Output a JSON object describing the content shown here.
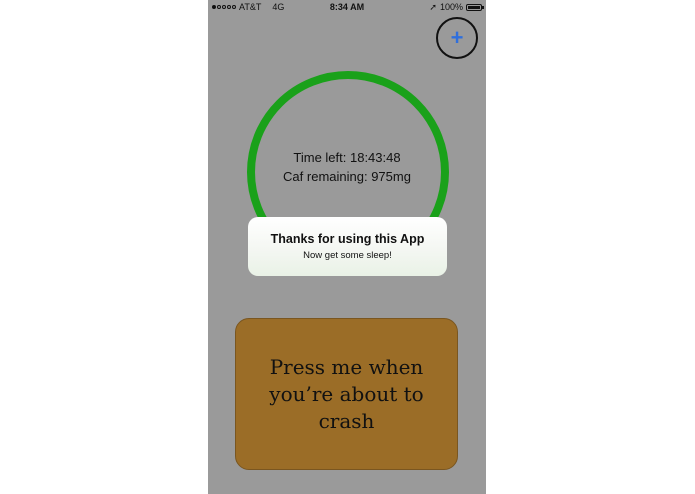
{
  "status_bar": {
    "carrier": "AT&T",
    "network": "4G",
    "time": "8:34 AM",
    "battery": "100%",
    "signal_bars_filled": 1,
    "signal_bars_total": 5
  },
  "header": {
    "add_label": "+"
  },
  "timer": {
    "time_left": "Time left: 18:43:48",
    "caffeine_remaining": "Caf remaining: 975mg",
    "ring_color": "#1aa11a"
  },
  "alert": {
    "title": "Thanks for using this App",
    "message": "Now get some sleep!"
  },
  "crash_button": {
    "label": "Press me when you’re about to crash",
    "color": "#9b6d27"
  },
  "colors": {
    "background": "#9a9a9a",
    "add_icon": "#2f6fdc"
  }
}
